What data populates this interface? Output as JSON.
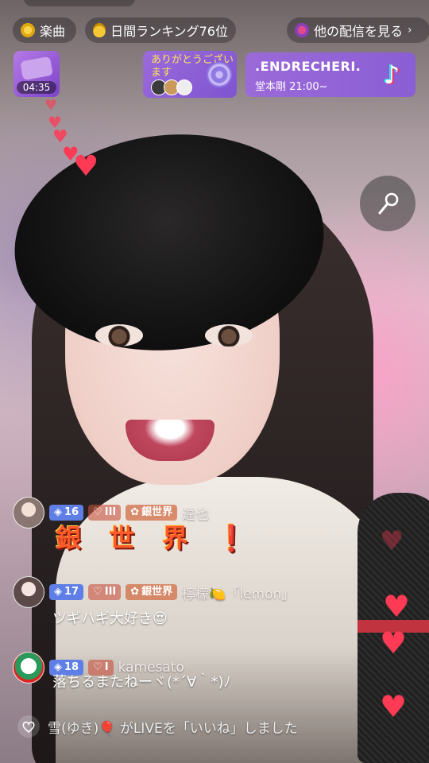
{
  "topbar": {
    "music_label": "楽曲",
    "ranking_label": "日間ランキング76位",
    "others_label": "他の配信を見る",
    "chevron": "›"
  },
  "treasure_box": {
    "timer": "04:35",
    "icon": "gift-icon"
  },
  "thanks_banner": {
    "text": "ありがとうございます"
  },
  "tiktok_banner": {
    "name": ".ENDRECHERI.",
    "schedule": "堂本剛 21:00~"
  },
  "mic_button": {
    "icon": "microphone-icon"
  },
  "chat": [
    {
      "level": "16",
      "fan_level": "III",
      "club": "銀世界",
      "username": "達也",
      "message": "銀 世 界 ❗"
    },
    {
      "level": "17",
      "fan_level": "III",
      "club": "銀世界",
      "username": "檸檬🍋「lemon」",
      "message": "ツギハギ大好き😍"
    },
    {
      "level": "18",
      "fan_level": "I",
      "club": "",
      "username": "kamesato",
      "message": "落ちるまたねーヾ(*´∀｀*)ﾉ"
    }
  ],
  "like_notice": {
    "text": "雪(ゆき)🎈 がLIVEを「いいね」しました",
    "icon": "heart-outline-icon"
  },
  "colors": {
    "level_badge": "#5f7fe6",
    "heart": "#ff3a55",
    "banner_purple": "#8a5ed4"
  }
}
